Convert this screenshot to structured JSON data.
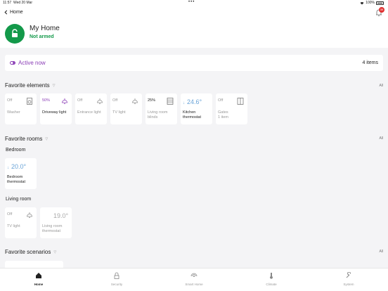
{
  "status_bar": {
    "time": "11:57",
    "date": "Wed 20 Mar",
    "dots": "•••",
    "battery": "100%"
  },
  "header": {
    "back_label": "Home",
    "notification_count": "39",
    "title": "My Home",
    "arm_status": "Not armed"
  },
  "active_now": {
    "label": "Active now",
    "count": "4 items"
  },
  "favorite_elements": {
    "title": "Favorite elements",
    "all": "All",
    "items": [
      {
        "value": "Off",
        "name": "Washer",
        "icon": "washer-icon"
      },
      {
        "value": "50%",
        "name": "Driveway light",
        "icon": "lamp-icon"
      },
      {
        "value": "Off",
        "name": "Entrance light",
        "icon": "lamp-icon"
      },
      {
        "value": "Off",
        "name": "TV light",
        "icon": "lamp-icon"
      },
      {
        "value": "25%",
        "name": "Living room blinds",
        "icon": "blinds-icon"
      },
      {
        "value": "24.6°",
        "name": "Kitchen thermostat",
        "icon": "down-arrow-icon"
      },
      {
        "value": "Off",
        "name": "Gates",
        "sub": "1 item",
        "icon": "gate-icon"
      }
    ]
  },
  "favorite_rooms": {
    "title": "Favorite rooms",
    "all": "All",
    "rooms": [
      {
        "name": "Bedroom",
        "items": [
          {
            "value": "20.0°",
            "name": "Bedroom thermostat"
          }
        ]
      },
      {
        "name": "Living room",
        "items": [
          {
            "value": "Off",
            "name": "TV light"
          },
          {
            "value": "19.0°",
            "name": "Living room thermostat"
          }
        ]
      }
    ]
  },
  "favorite_scenarios": {
    "title": "Favorite scenarios",
    "all": "All"
  },
  "colors": {
    "accent": "#8a3db6",
    "armed_green": "#13994a",
    "temp_blue": "#6aa4d8"
  },
  "tabs": [
    {
      "label": "Home",
      "icon": "home-icon"
    },
    {
      "label": "Security",
      "icon": "lock-icon"
    },
    {
      "label": "Smart Home",
      "icon": "smart-home-icon"
    },
    {
      "label": "Climate",
      "icon": "thermometer-icon"
    },
    {
      "label": "System",
      "icon": "wrench-icon"
    }
  ]
}
